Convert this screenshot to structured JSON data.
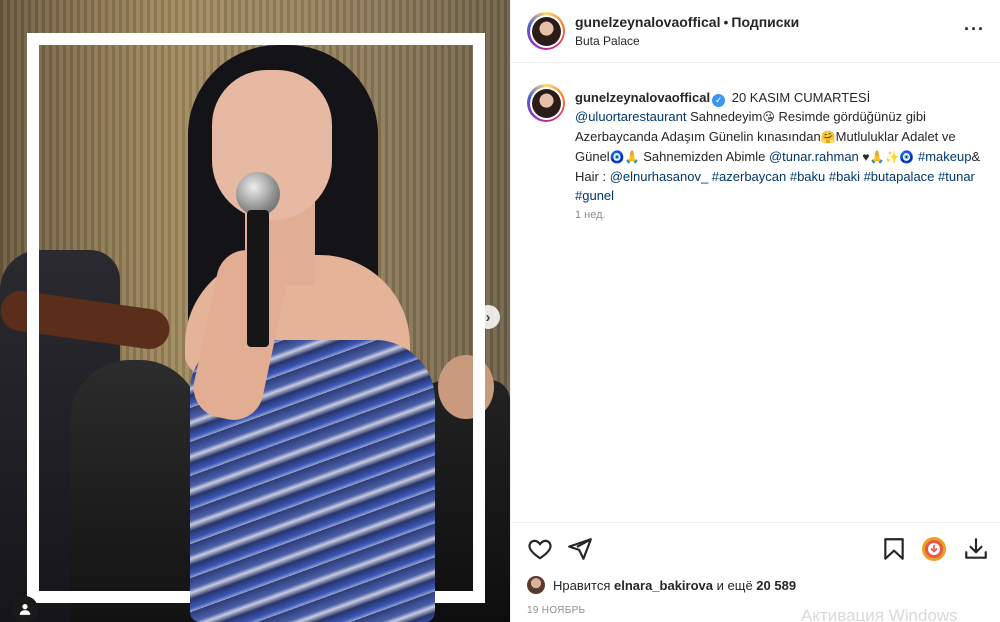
{
  "header": {
    "username": "gunelzeynalovaoffical",
    "separator": "•",
    "follow_label": "Подписки",
    "location": "Buta Palace",
    "more_icon": "more-horizontal-icon"
  },
  "caption": {
    "username": "gunelzeynalovaoffical",
    "verified_icon": "verified-badge-icon",
    "seg1": "20 KASIM CUMARTESİ",
    "mention1": "@uluortarestaurant",
    "seg2": "Sahnedeyim",
    "emoji1": "😘",
    "seg3": " Resimde gördüğünüz gibi Azerbaycanda Adaşım Günelin kınasından",
    "emoji2": "🤗",
    "seg4": "Mutluluklar Adalet ve Günel",
    "emoji3": "🧿🙏",
    "seg5": "Sahnemizden Abimle",
    "mention2": "@tunar.rahman",
    "emoji4": "♥🙏✨🧿",
    "tag1": "#makeup",
    "seg6": "& Hair :",
    "mention3": "@elnurhasanov_",
    "tags": "#azerbaycan #baku #baki #butapalace #tunar #gunel",
    "time": "1 нед."
  },
  "actions": {
    "like_icon": "heart-icon",
    "share_icon": "send-icon",
    "save_icon": "bookmark-icon",
    "download_icon": "download-icon"
  },
  "likes": {
    "prefix": "Нравится",
    "user": "elnara_bakirova",
    "middle": "и ещё",
    "count": "20 589"
  },
  "date": "19 НОЯБРЬ",
  "watermark": "Активация Windows",
  "media": {
    "next_icon": "chevron-right-icon",
    "tagged_icon": "user-tag-icon"
  }
}
